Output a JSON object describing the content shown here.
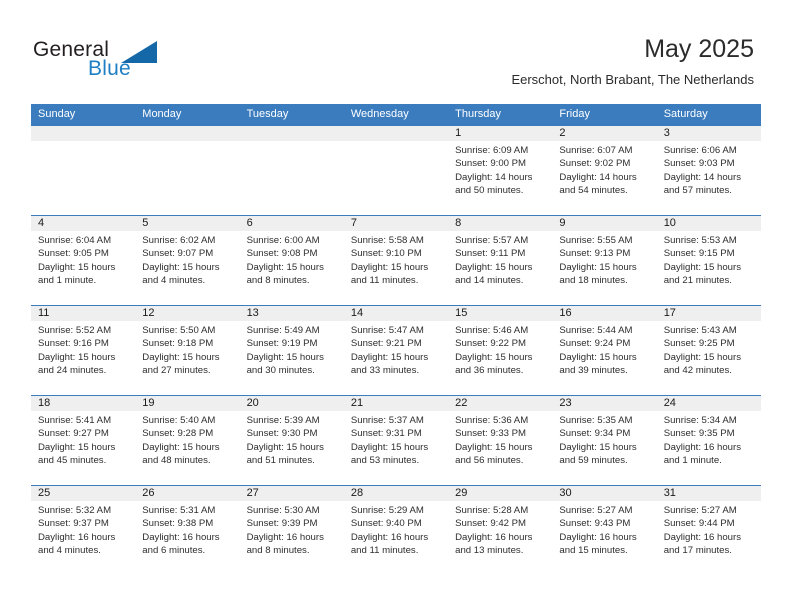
{
  "brand": {
    "name_part1": "General",
    "name_part2": "Blue",
    "triangle_color": "#1468a8",
    "blue_color": "#1f7fc4"
  },
  "header": {
    "month_title": "May 2025",
    "location": "Eerschot, North Brabant, The Netherlands"
  },
  "calendar": {
    "header_bg": "#3b7cbf",
    "day_band_bg": "#efefef",
    "weekdays": [
      "Sunday",
      "Monday",
      "Tuesday",
      "Wednesday",
      "Thursday",
      "Friday",
      "Saturday"
    ],
    "weeks": [
      [
        {
          "day": "",
          "lines": []
        },
        {
          "day": "",
          "lines": []
        },
        {
          "day": "",
          "lines": []
        },
        {
          "day": "",
          "lines": []
        },
        {
          "day": "1",
          "lines": [
            "Sunrise: 6:09 AM",
            "Sunset: 9:00 PM",
            "Daylight: 14 hours",
            "and 50 minutes."
          ]
        },
        {
          "day": "2",
          "lines": [
            "Sunrise: 6:07 AM",
            "Sunset: 9:02 PM",
            "Daylight: 14 hours",
            "and 54 minutes."
          ]
        },
        {
          "day": "3",
          "lines": [
            "Sunrise: 6:06 AM",
            "Sunset: 9:03 PM",
            "Daylight: 14 hours",
            "and 57 minutes."
          ]
        }
      ],
      [
        {
          "day": "4",
          "lines": [
            "Sunrise: 6:04 AM",
            "Sunset: 9:05 PM",
            "Daylight: 15 hours",
            "and 1 minute."
          ]
        },
        {
          "day": "5",
          "lines": [
            "Sunrise: 6:02 AM",
            "Sunset: 9:07 PM",
            "Daylight: 15 hours",
            "and 4 minutes."
          ]
        },
        {
          "day": "6",
          "lines": [
            "Sunrise: 6:00 AM",
            "Sunset: 9:08 PM",
            "Daylight: 15 hours",
            "and 8 minutes."
          ]
        },
        {
          "day": "7",
          "lines": [
            "Sunrise: 5:58 AM",
            "Sunset: 9:10 PM",
            "Daylight: 15 hours",
            "and 11 minutes."
          ]
        },
        {
          "day": "8",
          "lines": [
            "Sunrise: 5:57 AM",
            "Sunset: 9:11 PM",
            "Daylight: 15 hours",
            "and 14 minutes."
          ]
        },
        {
          "day": "9",
          "lines": [
            "Sunrise: 5:55 AM",
            "Sunset: 9:13 PM",
            "Daylight: 15 hours",
            "and 18 minutes."
          ]
        },
        {
          "day": "10",
          "lines": [
            "Sunrise: 5:53 AM",
            "Sunset: 9:15 PM",
            "Daylight: 15 hours",
            "and 21 minutes."
          ]
        }
      ],
      [
        {
          "day": "11",
          "lines": [
            "Sunrise: 5:52 AM",
            "Sunset: 9:16 PM",
            "Daylight: 15 hours",
            "and 24 minutes."
          ]
        },
        {
          "day": "12",
          "lines": [
            "Sunrise: 5:50 AM",
            "Sunset: 9:18 PM",
            "Daylight: 15 hours",
            "and 27 minutes."
          ]
        },
        {
          "day": "13",
          "lines": [
            "Sunrise: 5:49 AM",
            "Sunset: 9:19 PM",
            "Daylight: 15 hours",
            "and 30 minutes."
          ]
        },
        {
          "day": "14",
          "lines": [
            "Sunrise: 5:47 AM",
            "Sunset: 9:21 PM",
            "Daylight: 15 hours",
            "and 33 minutes."
          ]
        },
        {
          "day": "15",
          "lines": [
            "Sunrise: 5:46 AM",
            "Sunset: 9:22 PM",
            "Daylight: 15 hours",
            "and 36 minutes."
          ]
        },
        {
          "day": "16",
          "lines": [
            "Sunrise: 5:44 AM",
            "Sunset: 9:24 PM",
            "Daylight: 15 hours",
            "and 39 minutes."
          ]
        },
        {
          "day": "17",
          "lines": [
            "Sunrise: 5:43 AM",
            "Sunset: 9:25 PM",
            "Daylight: 15 hours",
            "and 42 minutes."
          ]
        }
      ],
      [
        {
          "day": "18",
          "lines": [
            "Sunrise: 5:41 AM",
            "Sunset: 9:27 PM",
            "Daylight: 15 hours",
            "and 45 minutes."
          ]
        },
        {
          "day": "19",
          "lines": [
            "Sunrise: 5:40 AM",
            "Sunset: 9:28 PM",
            "Daylight: 15 hours",
            "and 48 minutes."
          ]
        },
        {
          "day": "20",
          "lines": [
            "Sunrise: 5:39 AM",
            "Sunset: 9:30 PM",
            "Daylight: 15 hours",
            "and 51 minutes."
          ]
        },
        {
          "day": "21",
          "lines": [
            "Sunrise: 5:37 AM",
            "Sunset: 9:31 PM",
            "Daylight: 15 hours",
            "and 53 minutes."
          ]
        },
        {
          "day": "22",
          "lines": [
            "Sunrise: 5:36 AM",
            "Sunset: 9:33 PM",
            "Daylight: 15 hours",
            "and 56 minutes."
          ]
        },
        {
          "day": "23",
          "lines": [
            "Sunrise: 5:35 AM",
            "Sunset: 9:34 PM",
            "Daylight: 15 hours",
            "and 59 minutes."
          ]
        },
        {
          "day": "24",
          "lines": [
            "Sunrise: 5:34 AM",
            "Sunset: 9:35 PM",
            "Daylight: 16 hours",
            "and 1 minute."
          ]
        }
      ],
      [
        {
          "day": "25",
          "lines": [
            "Sunrise: 5:32 AM",
            "Sunset: 9:37 PM",
            "Daylight: 16 hours",
            "and 4 minutes."
          ]
        },
        {
          "day": "26",
          "lines": [
            "Sunrise: 5:31 AM",
            "Sunset: 9:38 PM",
            "Daylight: 16 hours",
            "and 6 minutes."
          ]
        },
        {
          "day": "27",
          "lines": [
            "Sunrise: 5:30 AM",
            "Sunset: 9:39 PM",
            "Daylight: 16 hours",
            "and 8 minutes."
          ]
        },
        {
          "day": "28",
          "lines": [
            "Sunrise: 5:29 AM",
            "Sunset: 9:40 PM",
            "Daylight: 16 hours",
            "and 11 minutes."
          ]
        },
        {
          "day": "29",
          "lines": [
            "Sunrise: 5:28 AM",
            "Sunset: 9:42 PM",
            "Daylight: 16 hours",
            "and 13 minutes."
          ]
        },
        {
          "day": "30",
          "lines": [
            "Sunrise: 5:27 AM",
            "Sunset: 9:43 PM",
            "Daylight: 16 hours",
            "and 15 minutes."
          ]
        },
        {
          "day": "31",
          "lines": [
            "Sunrise: 5:27 AM",
            "Sunset: 9:44 PM",
            "Daylight: 16 hours",
            "and 17 minutes."
          ]
        }
      ]
    ]
  }
}
